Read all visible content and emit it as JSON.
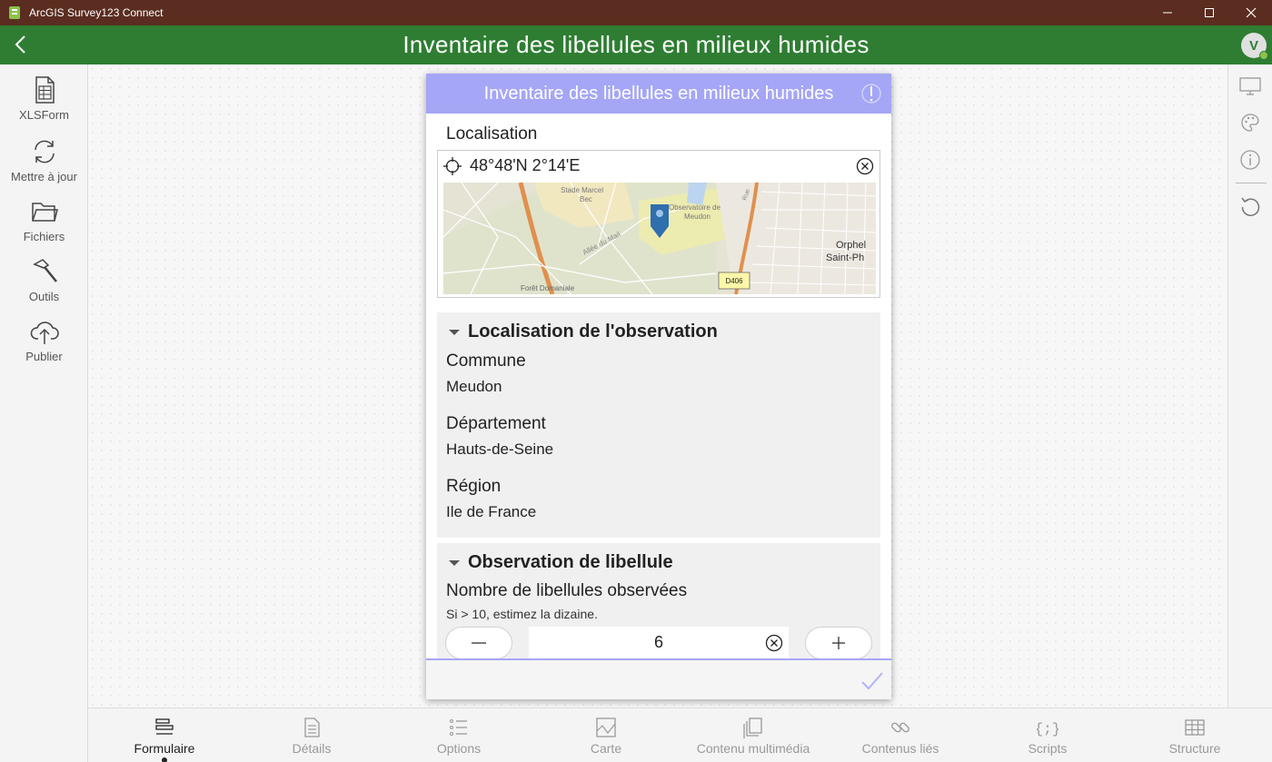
{
  "window": {
    "title": "ArcGIS Survey123 Connect",
    "icon": "survey123-app-icon"
  },
  "header": {
    "title": "Inventaire des libellules en milieux humides",
    "avatar": "V",
    "colors": {
      "bar": "#2e7d32",
      "titlebar": "#5a2d20"
    }
  },
  "sidebar": {
    "items": [
      {
        "label": "XLSForm",
        "icon": "spreadsheet-icon"
      },
      {
        "label": "Mettre à jour",
        "icon": "refresh-icon"
      },
      {
        "label": "Fichiers",
        "icon": "folder-icon"
      },
      {
        "label": "Outils",
        "icon": "hammer-icon"
      },
      {
        "label": "Publier",
        "icon": "cloud-upload-icon"
      }
    ]
  },
  "right_sidebar": {
    "icons": [
      "monitor-icon",
      "palette-icon",
      "info-icon",
      "undo-icon"
    ]
  },
  "form": {
    "title": "Inventaire des libellules en milieux humides",
    "header_color": "#a5a6f6",
    "location": {
      "label": "Localisation",
      "coordinates": "48°48'N 2°14'E",
      "map_labels": {
        "stade": "Stade Marcel\nBec",
        "observatoire": "Observatoire de\nMeudon",
        "allee": "Allée du Mail",
        "foret": "Forêt Domaniale",
        "orphel": "Orphel",
        "saint": "Saint-Ph",
        "road": "D406",
        "rue": "Rue"
      }
    },
    "groups": [
      {
        "title": "Localisation de l'observation",
        "fields": [
          {
            "label": "Commune",
            "value": "Meudon"
          },
          {
            "label": "Département",
            "value": "Hauts-de-Seine"
          },
          {
            "label": "Région",
            "value": "Ile de France"
          }
        ]
      },
      {
        "title": "Observation de libellule",
        "fields": [
          {
            "label": "Nombre de libellules observées",
            "hint": "Si > 10, estimez la dizaine.",
            "value": "6"
          }
        ]
      }
    ]
  },
  "bottom_tabs": [
    {
      "label": "Formulaire",
      "icon": "form-icon",
      "active": true
    },
    {
      "label": "Détails",
      "icon": "details-icon",
      "active": false
    },
    {
      "label": "Options",
      "icon": "options-list-icon",
      "active": false
    },
    {
      "label": "Carte",
      "icon": "map-icon",
      "active": false
    },
    {
      "label": "Contenu multimédia",
      "icon": "media-icon",
      "active": false
    },
    {
      "label": "Contenus liés",
      "icon": "link-icon",
      "active": false
    },
    {
      "label": "Scripts",
      "icon": "scripts-icon",
      "active": false
    },
    {
      "label": "Structure",
      "icon": "table-icon",
      "active": false
    }
  ]
}
